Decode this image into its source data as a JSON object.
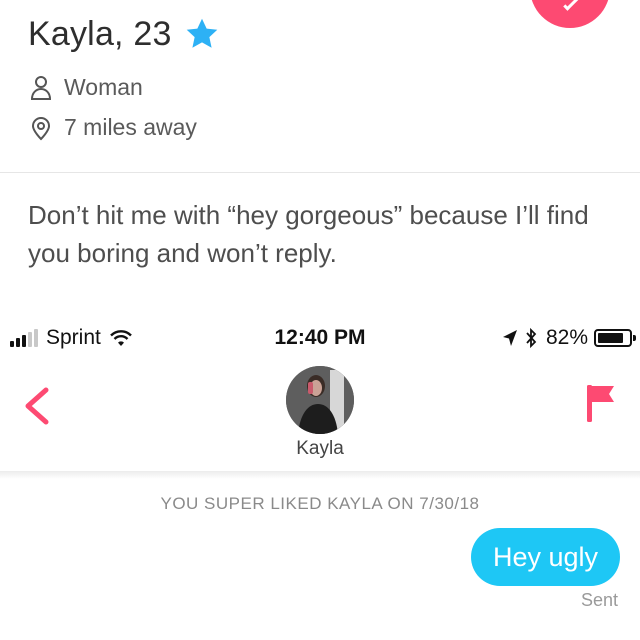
{
  "profile": {
    "name_age": "Kayla, 23",
    "gender": "Woman",
    "distance": "7 miles away",
    "bio": "Don’t hit me with “hey gorgeous” because I’ll find you boring and won’t reply."
  },
  "status_bar": {
    "carrier": "Sprint",
    "time": "12:40 PM",
    "battery_percent": "82%",
    "battery_level": 0.82
  },
  "chat": {
    "match_name": "Kayla",
    "superlike_note": "YOU SUPER LIKED KAYLA ON 7/30/18",
    "messages": [
      {
        "text": "Hey ugly",
        "status": "Sent"
      }
    ]
  },
  "icons": {
    "star": "star-icon",
    "gender": "person-icon",
    "location": "location-pin-icon",
    "back": "chevron-left-icon",
    "report": "flag-icon"
  },
  "colors": {
    "superlike_star": "#2db1f5",
    "accent_pink": "#fd4a72",
    "bubble_blue": "#1ec7f5"
  }
}
